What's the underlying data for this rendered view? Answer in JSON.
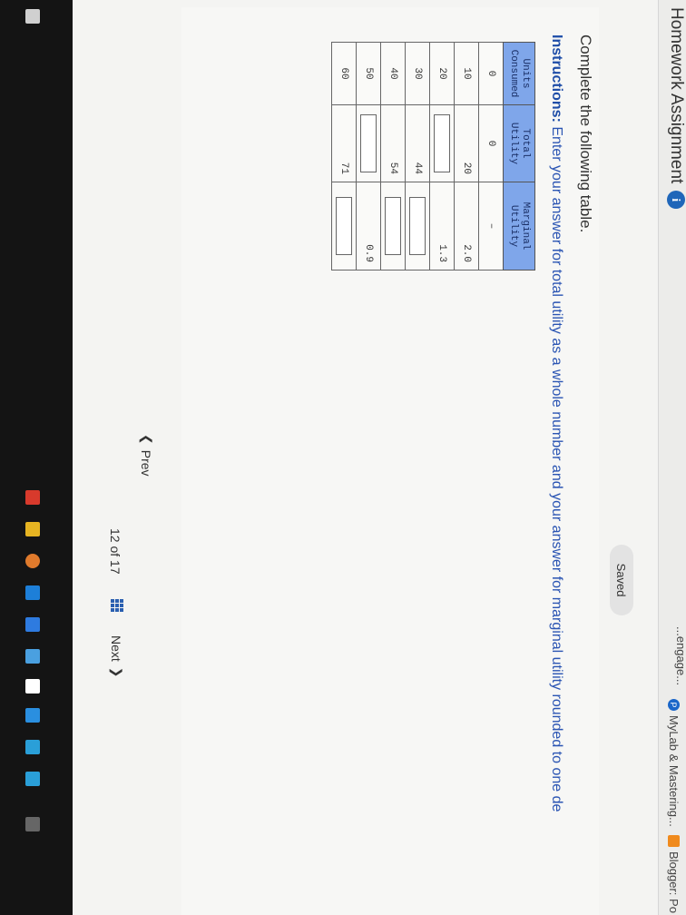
{
  "bookmarks": {
    "cengage": "...engage...",
    "mylab": "MyLab & Mastering...",
    "blogger": "Blogger: Po"
  },
  "header": {
    "title": "Homework Assignment",
    "info_icon": "info-icon",
    "saved": "Saved"
  },
  "question": {
    "prompt": "Complete the following table.",
    "instructions_label": "Instructions:",
    "instructions_text": " Enter your answer for total utility as a whole number and your answer for marginal utility rounded to one de"
  },
  "table": {
    "headers": [
      "Units\nConsumed",
      "Total\nUtility",
      "Marginal\nUtility"
    ],
    "rows": [
      {
        "units": "0",
        "total": "0",
        "marginal": "–"
      },
      {
        "units": "10",
        "total": "20",
        "marginal": "2.0"
      },
      {
        "units": "20",
        "total": "",
        "marginal": "1.3"
      },
      {
        "units": "30",
        "total": "44",
        "marginal": ""
      },
      {
        "units": "40",
        "total": "54",
        "marginal": ""
      },
      {
        "units": "50",
        "total": "",
        "marginal": "0.9"
      },
      {
        "units": "60",
        "total": "71",
        "marginal": ""
      }
    ]
  },
  "nav": {
    "prev": "Prev",
    "page": "12 of 17",
    "next": "Next"
  },
  "colors": {
    "header_blue": "#7fa6ea",
    "link_blue": "#2b55b3",
    "info_blue": "#1f66b9"
  }
}
